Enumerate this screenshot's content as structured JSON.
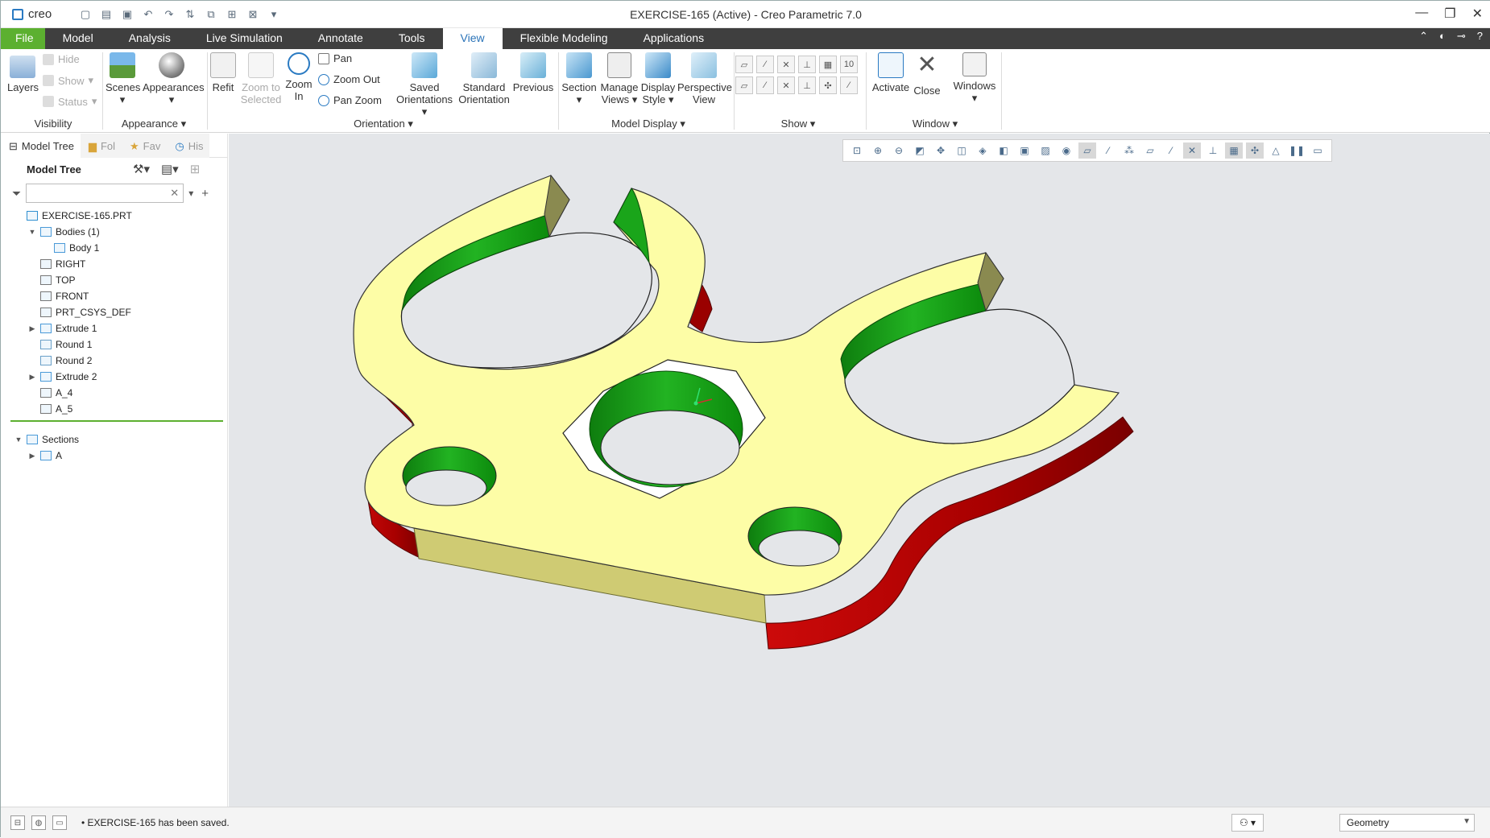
{
  "window": {
    "brand": "creo",
    "title": "EXERCISE-165 (Active) - Creo Parametric 7.0",
    "controls": [
      "—",
      "❐",
      "✕"
    ]
  },
  "tabs": [
    "File",
    "Model",
    "Analysis",
    "Live Simulation",
    "Annotate",
    "Tools",
    "View",
    "Flexible Modeling",
    "Applications"
  ],
  "active_tab": "View",
  "ribbon": {
    "layers": "Layers",
    "hide": "Hide",
    "show": "Show",
    "status": "Status",
    "scenes": "Scenes",
    "appearances": "Appearances",
    "refit": "Refit",
    "zoom_selected_1": "Zoom to",
    "zoom_selected_2": "Selected",
    "zoom_in_1": "Zoom",
    "zoom_in_2": "In",
    "pan": "Pan",
    "zoom_out": "Zoom Out",
    "pan_zoom": "Pan Zoom",
    "saved_orient_1": "Saved",
    "saved_orient_2": "Orientations",
    "standard_orient_1": "Standard",
    "standard_orient_2": "Orientation",
    "previous": "Previous",
    "section": "Section",
    "manage_views_1": "Manage",
    "manage_views_2": "Views",
    "display_style_1": "Display",
    "display_style_2": "Style",
    "perspective_1": "Perspective",
    "perspective_2": "View",
    "activate": "Activate",
    "close": "Close",
    "windows": "Windows",
    "groups": {
      "visibility": "Visibility",
      "appearance": "Appearance ▾",
      "orientation": "Orientation ▾",
      "model_display": "Model Display ▾",
      "show": "Show ▾",
      "window": "Window ▾"
    }
  },
  "panel": {
    "tabs": [
      "Model Tree",
      "Fol",
      "Fav",
      "His"
    ],
    "header": "Model Tree",
    "filter_placeholder": ""
  },
  "tree": [
    {
      "label": "EXERCISE-165.PRT",
      "indent": 0,
      "twisty": "",
      "color": "#2f8fd0"
    },
    {
      "label": "Bodies (1)",
      "indent": 1,
      "twisty": "▼",
      "color": "#4a9ad8"
    },
    {
      "label": "Body 1",
      "indent": 2,
      "twisty": "",
      "color": "#4a9ad8"
    },
    {
      "label": "RIGHT",
      "indent": 1,
      "twisty": "",
      "color": "#777"
    },
    {
      "label": "TOP",
      "indent": 1,
      "twisty": "",
      "color": "#777"
    },
    {
      "label": "FRONT",
      "indent": 1,
      "twisty": "",
      "color": "#777"
    },
    {
      "label": "PRT_CSYS_DEF",
      "indent": 1,
      "twisty": "",
      "color": "#777"
    },
    {
      "label": "Extrude 1",
      "indent": 1,
      "twisty": "▶",
      "color": "#4a9ad8"
    },
    {
      "label": "Round 1",
      "indent": 1,
      "twisty": "",
      "color": "#6aa0c8"
    },
    {
      "label": "Round 2",
      "indent": 1,
      "twisty": "",
      "color": "#6aa0c8"
    },
    {
      "label": "Extrude 2",
      "indent": 1,
      "twisty": "▶",
      "color": "#4a9ad8"
    },
    {
      "label": "A_4",
      "indent": 1,
      "twisty": "",
      "color": "#777"
    },
    {
      "label": "A_5",
      "indent": 1,
      "twisty": "",
      "color": "#777"
    }
  ],
  "sections_tree": [
    {
      "label": "Sections",
      "indent": 0,
      "twisty": "▼",
      "color": "#4a9ad8"
    },
    {
      "label": "A",
      "indent": 1,
      "twisty": "▶",
      "color": "#4a9ad8"
    }
  ],
  "status": {
    "message": "EXERCISE-165 has been saved.",
    "filter": "Geometry"
  },
  "model_colors": {
    "top_face": "#fdfda6",
    "inner_wall": "#1aa51a",
    "outer_wall": "#b80000",
    "flat_side": "#cfcb73",
    "counterbore": "#ffffff",
    "background": "#e4e6e9"
  }
}
